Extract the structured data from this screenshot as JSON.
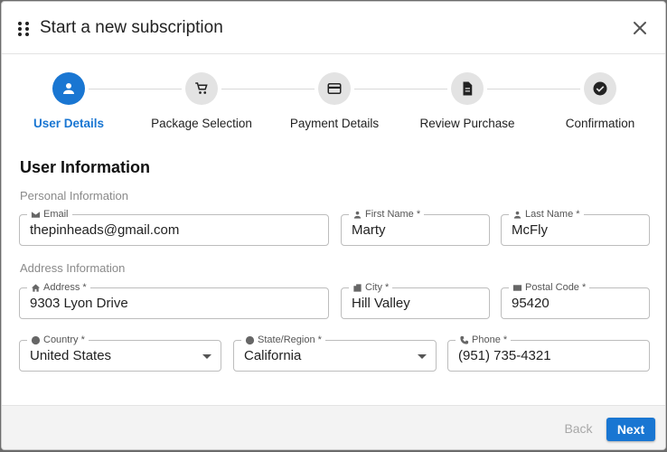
{
  "dialog": {
    "title": "Start a new subscription",
    "colors": {
      "accent": "#1976d2",
      "inactive_step": "#e3e3e3"
    }
  },
  "steps": [
    {
      "label": "User Details",
      "icon": "person-icon",
      "active": true
    },
    {
      "label": "Package Selection",
      "icon": "cart-icon",
      "active": false
    },
    {
      "label": "Payment Details",
      "icon": "credit-card-icon",
      "active": false
    },
    {
      "label": "Review Purchase",
      "icon": "document-icon",
      "active": false
    },
    {
      "label": "Confirmation",
      "icon": "check-circle-icon",
      "active": false
    }
  ],
  "form": {
    "section_title": "User Information",
    "personal_label": "Personal Information",
    "address_label": "Address Information",
    "email": {
      "label": "Email",
      "value": "thepinheads@gmail.com",
      "icon": "mail-icon"
    },
    "first_name": {
      "label": "First Name *",
      "value": "Marty",
      "icon": "person-icon"
    },
    "last_name": {
      "label": "Last Name *",
      "value": "McFly",
      "icon": "person-icon"
    },
    "address": {
      "label": "Address *",
      "value": "9303 Lyon Drive",
      "icon": "home-icon"
    },
    "city": {
      "label": "City *",
      "value": "Hill Valley",
      "icon": "building-icon"
    },
    "postal_code": {
      "label": "Postal Code *",
      "value": "95420",
      "icon": "mail-icon"
    },
    "country": {
      "label": "Country *",
      "value": "United States",
      "icon": "globe-icon"
    },
    "state": {
      "label": "State/Region *",
      "value": "California",
      "icon": "globe-icon"
    },
    "phone": {
      "label": "Phone *",
      "value": "(951) 735-4321",
      "icon": "phone-icon"
    }
  },
  "footer": {
    "back_label": "Back",
    "next_label": "Next"
  }
}
